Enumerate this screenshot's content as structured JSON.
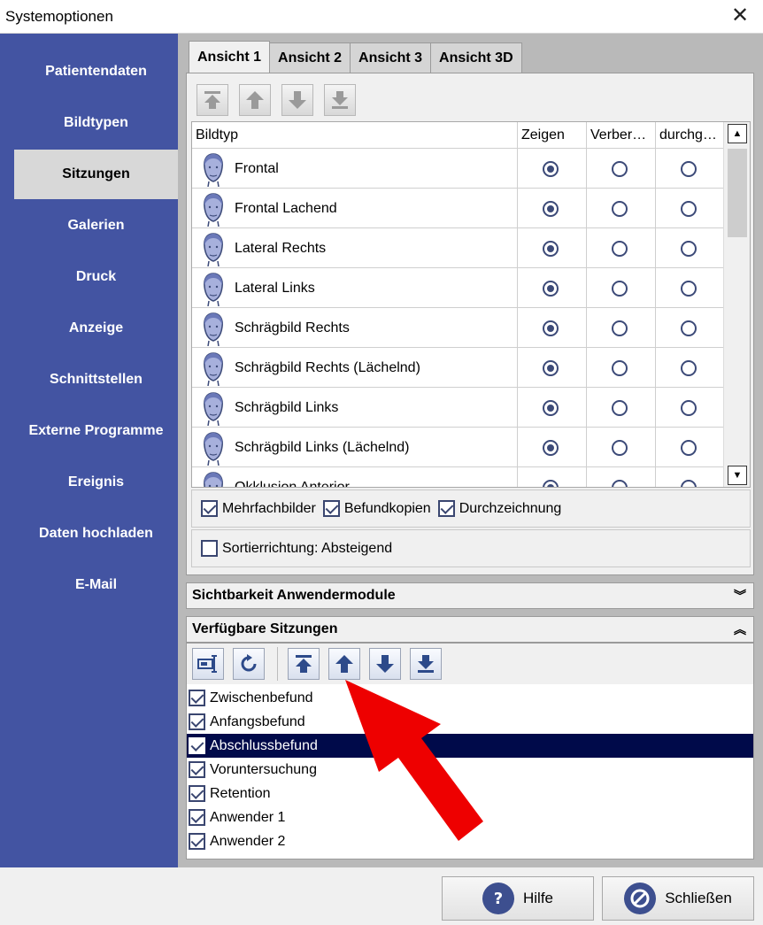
{
  "window": {
    "title": "Systemoptionen"
  },
  "sidebar": {
    "items": [
      {
        "label": "Patientendaten",
        "active": false
      },
      {
        "label": "Bildtypen",
        "active": false
      },
      {
        "label": "Sitzungen",
        "active": true
      },
      {
        "label": "Galerien",
        "active": false
      },
      {
        "label": "Druck",
        "active": false
      },
      {
        "label": "Anzeige",
        "active": false
      },
      {
        "label": "Schnittstellen",
        "active": false
      },
      {
        "label": "Externe Programme",
        "active": false
      },
      {
        "label": "Ereignis",
        "active": false
      },
      {
        "label": "Daten hochladen",
        "active": false
      },
      {
        "label": "E-Mail",
        "active": false
      }
    ]
  },
  "tabs": [
    "Ansicht 1",
    "Ansicht 2",
    "Ansicht 3",
    "Ansicht 3D"
  ],
  "grid": {
    "columns": [
      "Bildtyp",
      "Zeigen",
      "Verber…",
      "durchg…"
    ],
    "rows": [
      {
        "name": "Frontal",
        "selected": 0
      },
      {
        "name": "Frontal Lachend",
        "selected": 0
      },
      {
        "name": "Lateral Rechts",
        "selected": 0
      },
      {
        "name": "Lateral Links",
        "selected": 0
      },
      {
        "name": "Schrägbild Rechts",
        "selected": 0
      },
      {
        "name": "Schrägbild Rechts (Lächelnd)",
        "selected": 0
      },
      {
        "name": "Schrägbild Links",
        "selected": 0
      },
      {
        "name": "Schrägbild Links (Lächelnd)",
        "selected": 0
      },
      {
        "name": "Okklusion Anterior",
        "selected": 0
      }
    ]
  },
  "options": {
    "mehrfachbilder": "Mehrfachbilder",
    "befundkopien": "Befundkopien",
    "durchzeichnung": "Durchzeichnung",
    "sortierrichtung": "Sortierrichtung: Absteigend"
  },
  "sections": {
    "module_visibility": "Sichtbarkeit Anwendermodule",
    "available_sessions": "Verfügbare Sitzungen"
  },
  "sessions": [
    {
      "label": "Zwischenbefund",
      "checked": true,
      "selected": false
    },
    {
      "label": "Anfangsbefund",
      "checked": true,
      "selected": false
    },
    {
      "label": "Abschlussbefund",
      "checked": true,
      "selected": true
    },
    {
      "label": "Voruntersuchung",
      "checked": true,
      "selected": false
    },
    {
      "label": "Retention",
      "checked": true,
      "selected": false
    },
    {
      "label": "Anwender 1",
      "checked": true,
      "selected": false
    },
    {
      "label": "Anwender 2",
      "checked": true,
      "selected": false
    }
  ],
  "footer": {
    "help_label": "Hilfe",
    "close_label": "Schließen"
  },
  "colors": {
    "sidebar": "#4354a2",
    "selection": "#000a4a",
    "annotation_arrow": "#ee0000"
  }
}
